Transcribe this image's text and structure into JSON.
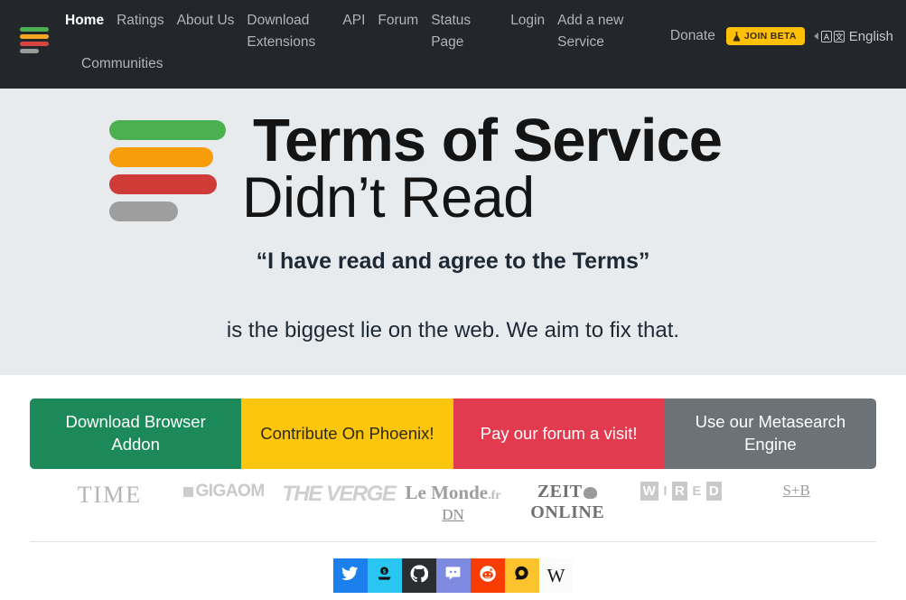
{
  "nav": {
    "logo_name": "tosdr-logo",
    "links": [
      {
        "label": "Home",
        "active": true
      },
      {
        "label": "Ratings",
        "active": false
      },
      {
        "label": "About Us",
        "active": false
      },
      {
        "label": "Download Extensions",
        "active": false
      },
      {
        "label": "API",
        "active": false
      },
      {
        "label": "Forum",
        "active": false
      },
      {
        "label": "Status Page",
        "active": false
      },
      {
        "label": "Login",
        "active": false
      },
      {
        "label": "Add a new Service",
        "active": false
      },
      {
        "label": "Communities",
        "active": false
      }
    ],
    "donate_label": "Donate",
    "beta_label": "JOIN BETA",
    "beta_icon": "flask-icon",
    "language_label": "English",
    "language_icon": "translate-icon",
    "colors": {
      "background": "#23272b",
      "beta_background": "#ffc107",
      "link": "#b0b4b8",
      "link_active": "#ffffff"
    }
  },
  "hero": {
    "title_line1": "Terms of Service",
    "title_line2": "Didn’t Read",
    "quote": "“I have read and agree to the Terms”",
    "subtitle": "is the biggest lie on the web. We aim to fix that.",
    "background": "#e8ebed",
    "logo_bars": [
      {
        "color": "#4caf50",
        "name": "grade-a-bar"
      },
      {
        "color": "#f79d0c",
        "name": "grade-b-bar"
      },
      {
        "color": "#cf3b36",
        "name": "grade-c-bar"
      },
      {
        "color": "#9e9e9e",
        "name": "grade-n-bar"
      }
    ]
  },
  "cta": {
    "buttons": [
      {
        "label": "Download Browser Addon",
        "color": "#1b8a58",
        "name": "download-browser-addon-button"
      },
      {
        "label": "Contribute On Phoenix!",
        "color": "#fcc60d",
        "name": "contribute-on-phoenix-button"
      },
      {
        "label": "Pay our forum a visit!",
        "color": "#e23a4e",
        "name": "forum-visit-button"
      },
      {
        "label": "Use our Metasearch Engine",
        "color": "#6b7278",
        "name": "metasearch-engine-button"
      }
    ]
  },
  "press": {
    "time": "TIME",
    "gigaom": "GIGAOM",
    "verge": "THE VERGE",
    "lemonde_main": "Le Monde",
    "lemonde_suffix": ".fr",
    "dn": "DN",
    "zeit_left": "ZEIT",
    "zeit_right": "ONLINE",
    "wired": [
      "W",
      "I",
      "R",
      "E",
      "D"
    ],
    "sb": "S+B"
  },
  "social": {
    "items": [
      {
        "name": "twitter-icon",
        "label": "Twitter",
        "class": "twitter"
      },
      {
        "name": "open-collective-icon",
        "label": "Open Collective",
        "class": "opencollective"
      },
      {
        "name": "github-icon",
        "label": "GitHub",
        "class": "github"
      },
      {
        "name": "discord-icon",
        "label": "Discord",
        "class": "discord"
      },
      {
        "name": "reddit-icon",
        "label": "Reddit",
        "class": "reddit"
      },
      {
        "name": "disqus-icon",
        "label": "Disqus",
        "class": "disqus"
      },
      {
        "name": "wikipedia-icon",
        "label": "Wikipedia",
        "class": "wikipedia",
        "glyph": "W"
      }
    ]
  }
}
